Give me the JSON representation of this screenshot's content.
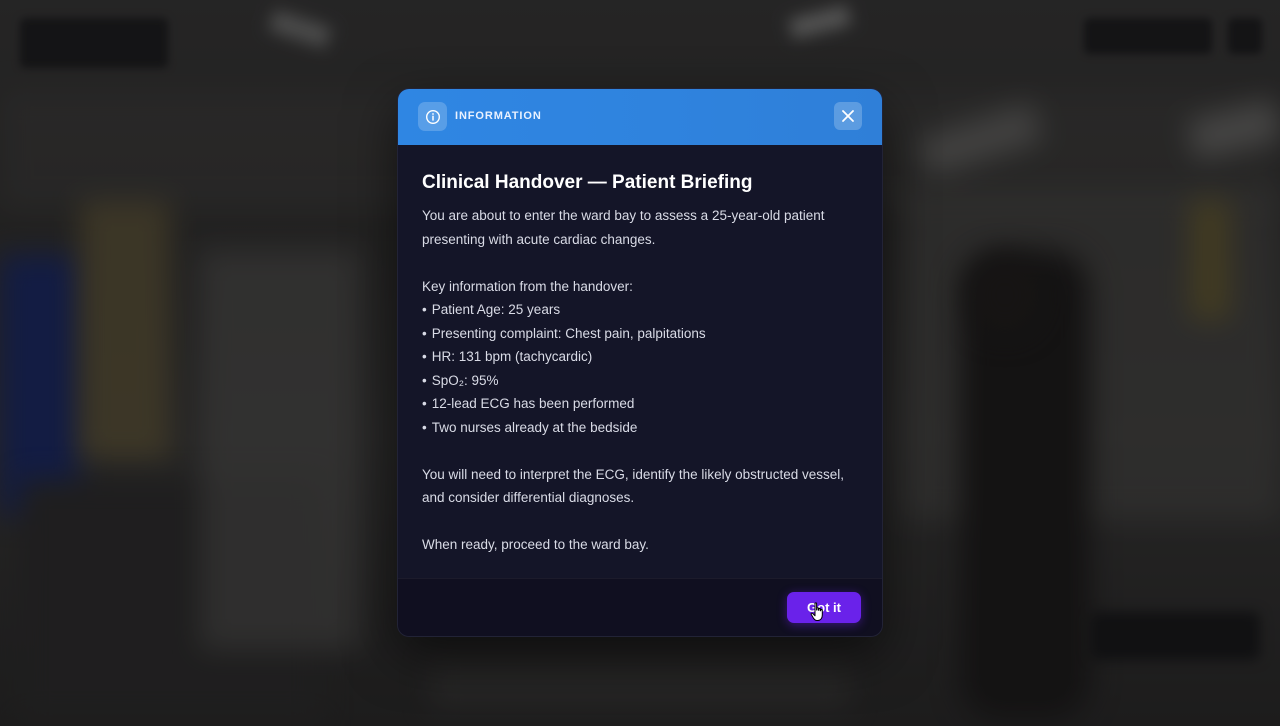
{
  "modal": {
    "header_label": "INFORMATION",
    "title": "Clinical Handover — Patient Briefing",
    "intro": "You are about to enter the ward bay to assess a 25-year-old patient presenting with acute cardiac changes.",
    "key_info_heading": "Key information from the handover:",
    "bullets": [
      "Patient Age: 25 years",
      "Presenting complaint: Chest pain, palpitations",
      "HR: 131 bpm (tachycardic)",
      "SpO₂: 95%",
      "12-lead ECG has been performed",
      "Two nurses already at the bedside"
    ],
    "instructions": "You will need to interpret the ECG, identify the likely obstructed vessel, and consider differential diagnoses.",
    "closing": "When ready, proceed to the ward bay.",
    "confirm_label": "Got it",
    "bullet_char": "•"
  },
  "icons": {
    "header": "info-icon",
    "close": "close-icon",
    "cursor": "hand-pointer-icon"
  },
  "colors": {
    "header_accent": "#2f86e3",
    "button_accent": "#6a22ea",
    "modal_bg": "#141528"
  }
}
